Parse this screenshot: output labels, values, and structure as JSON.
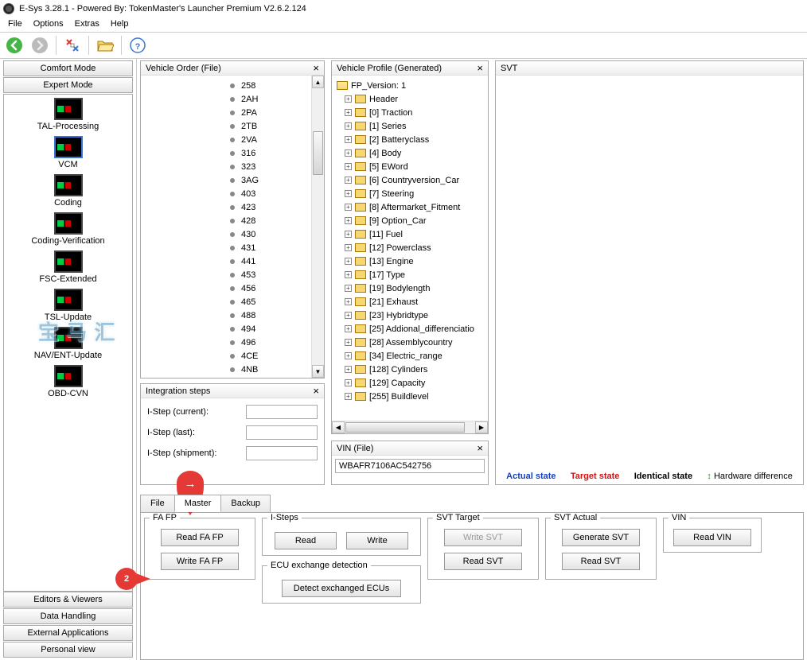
{
  "title": "E-Sys 3.28.1 - Powered By: TokenMaster's Launcher Premium V2.6.2.124",
  "menu": {
    "file": "File",
    "options": "Options",
    "extras": "Extras",
    "help": "Help"
  },
  "sidebar": {
    "top_buttons": [
      "Comfort Mode",
      "Expert Mode"
    ],
    "items": [
      {
        "label": "TAL-Processing",
        "selected": false
      },
      {
        "label": "VCM",
        "selected": true
      },
      {
        "label": "Coding",
        "selected": false
      },
      {
        "label": "Coding-Verification",
        "selected": false
      },
      {
        "label": "FSC-Extended",
        "selected": false
      },
      {
        "label": "TSL-Update",
        "selected": false
      },
      {
        "label": "NAV/ENT-Update",
        "selected": false
      },
      {
        "label": "OBD-CVN",
        "selected": false
      }
    ],
    "bottom_buttons": [
      "Editors & Viewers",
      "Data Handling",
      "External Applications",
      "Personal view"
    ]
  },
  "vehicle_order": {
    "title": "Vehicle Order (File)",
    "items": [
      "258",
      "2AH",
      "2PA",
      "2TB",
      "2VA",
      "316",
      "323",
      "3AG",
      "403",
      "423",
      "428",
      "430",
      "431",
      "441",
      "453",
      "456",
      "465",
      "488",
      "494",
      "496",
      "4CE",
      "4NB"
    ]
  },
  "vehicle_profile": {
    "title": "Vehicle Profile (Generated)",
    "root": "FP_Version: 1",
    "nodes": [
      "Header",
      "[0] Traction",
      "[1] Series",
      "[2] Batteryclass",
      "[4] Body",
      "[5] EWord",
      "[6] Countryversion_Car",
      "[7] Steering",
      "[8] Aftermarket_Fitment",
      "[9] Option_Car",
      "[11] Fuel",
      "[12] Powerclass",
      "[13] Engine",
      "[17] Type",
      "[19] Bodylength",
      "[21] Exhaust",
      "[23] Hybridtype",
      "[25] Addional_differenciatio",
      "[28] Assemblycountry",
      "[34] Electric_range",
      "[128] Cylinders",
      "[129] Capacity",
      "[255] Buildlevel"
    ]
  },
  "integration": {
    "title": "Integration steps",
    "rows": [
      {
        "label": "I-Step (current):",
        "value": ""
      },
      {
        "label": "I-Step (last):",
        "value": ""
      },
      {
        "label": "I-Step (shipment):",
        "value": ""
      }
    ]
  },
  "svt": {
    "title": "SVT",
    "legend": {
      "actual": "Actual state",
      "target": "Target state",
      "identical": "Identical state",
      "hw": "Hardware difference"
    }
  },
  "vin": {
    "title": "VIN (File)",
    "value": "WBAFR7106AC542756"
  },
  "tabs": {
    "file": "File",
    "master": "Master",
    "backup": "Backup"
  },
  "master": {
    "fa_fp": {
      "legend": "FA FP",
      "read": "Read FA FP",
      "write": "Write FA FP"
    },
    "isteps": {
      "legend": "I-Steps",
      "read": "Read",
      "write": "Write",
      "ecu_legend": "ECU exchange detection",
      "detect": "Detect exchanged ECUs"
    },
    "svt_target": {
      "legend": "SVT Target",
      "write": "Write SVT",
      "read": "Read SVT"
    },
    "svt_actual": {
      "legend": "SVT Actual",
      "generate": "Generate SVT",
      "read": "Read SVT"
    },
    "vin": {
      "legend": "VIN",
      "read": "Read VIN"
    }
  },
  "watermark": "宝 马 汇",
  "annotations": {
    "pin": "→",
    "circle": "2"
  }
}
